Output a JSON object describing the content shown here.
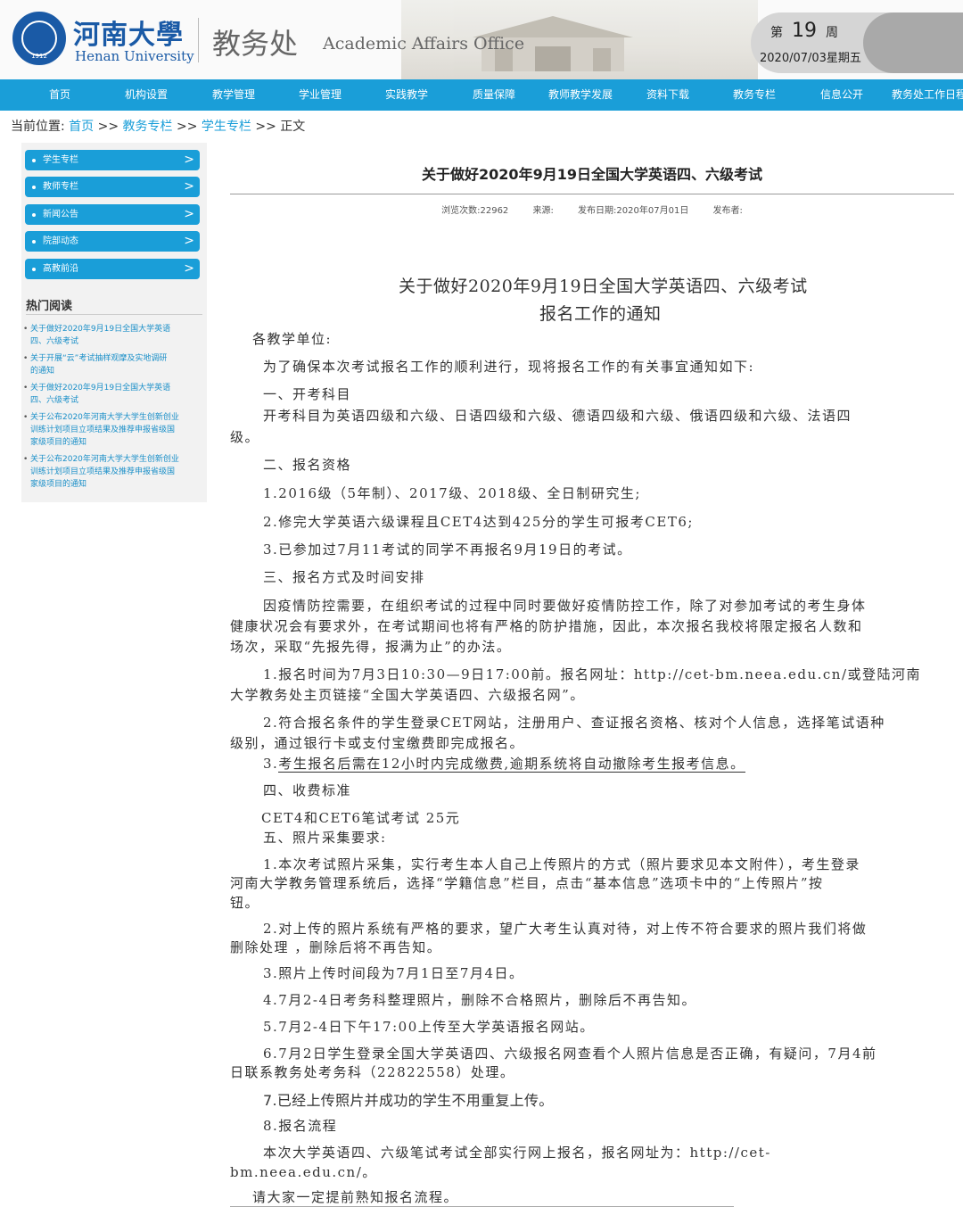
{
  "header": {
    "logo_year": "1912",
    "university_cn": "河南大學",
    "university_en": "Henan University",
    "office_cn": "教务处",
    "office_en": "Academic Affairs Office",
    "week_prefix": "第",
    "week_number": "19",
    "week_suffix": "周",
    "date": "2020/07/03星期五"
  },
  "nav": [
    "首页",
    "机构设置",
    "教学管理",
    "学业管理",
    "实践教学",
    "质量保障",
    "教师教学发展",
    "资料下载",
    "教务专栏",
    "信息公开",
    "教务处工作日程"
  ],
  "breadcrumb": {
    "label": "当前位置:",
    "home": "首页",
    "sep": ">>",
    "level1": "教务专栏",
    "level2": "学生专栏",
    "current": "正文"
  },
  "sidebar": {
    "menu": [
      "学生专栏",
      "教师专栏",
      "新闻公告",
      "院部动态",
      "高教前沿"
    ],
    "arrow": ">",
    "hot_title": "热门阅读",
    "hot": [
      [
        "关于做好2020年9月19日全国大学英语",
        "四、六级考试"
      ],
      [
        "关于开展“云”考试抽样观摩及实地调研",
        "的通知"
      ],
      [
        "关于做好2020年9月19日全国大学英语",
        "四、六级考试"
      ],
      [
        "关于公布2020年河南大学大学生创新创业",
        "训练计划项目立项结果及推荐申报省级国",
        "家级项目的通知"
      ],
      [
        "关于公布2020年河南大学大学生创新创业",
        "训练计划项目立项结果及推荐申报省级国",
        "家级项目的通知"
      ]
    ]
  },
  "article": {
    "title": "关于做好2020年9月19日全国大学英语四、六级考试",
    "meta": {
      "views": "浏览次数:22962",
      "source": "来源:",
      "date": "发布日期:2020年07月01日",
      "author": "发布者:"
    },
    "heading1": "关于做好2020年9月19日全国大学英语四、六级考试",
    "heading2": "报名工作的通知",
    "lines": [
      "各教学单位:",
      "为了确保本次考试报名工作的顺利进行，现将报名工作的有关事宜通知如下:",
      "一、开考科目",
      "开考科目为英语四级和六级、日语四级和六级、德语四级和六级、俄语四级和六级、法语四",
      "级。",
      "二、报名资格",
      "1.2016级（5年制）、2017级、2018级、全日制研究生;",
      "2.修完大学英语六级课程且CET4达到425分的学生可报考CET6;",
      "3.已参加过7月11考试的同学不再报名9月19日的考试。",
      "三、报名方式及时间安排",
      "因疫情防控需要，在组织考试的过程中同时要做好疫情防控工作，除了对参加考试的考生身体",
      "健康状况会有要求外，在考试期间也将有严格的防护措施，因此，本次报名我校将限定报名人数和",
      "场次，采取“先报先得，报满为止”的办法。",
      "1.报名时间为7月3日10:30—9日17:00前。报名网址：http://cet-bm.neea.edu.cn/或登陆河南",
      "大学教务处主页链接“全国大学英语四、六级报名网”。",
      "2.符合报名条件的学生登录CET网站，注册用户、查证报名资格、核对个人信息，选择笔试语种",
      "级别，通过银行卡或支付宝缴费即完成报名。",
      "3.",
      "考生报名后需在12小时内完成缴费,逾期系统将自动撤除考生报考信息。",
      "四、收费标准",
      "CET4和CET6笔试考试 25元",
      "五、照片采集要求:",
      "1.本次考试照片采集，实行考生本人自己上传照片的方式（照片要求见本文附件），考生登录",
      "河南大学教务管理系统后，选择“学籍信息”栏目，点击“基本信息”选项卡中的“上传照片”按",
      "钮。",
      "2.对上传的照片系统有严格的要求，望广大考生认真对待，对上传不符合要求的照片我们将做",
      "删除处理 ，删除后将不再告知。",
      "3.照片上传时间段为7月1日至7月4日。",
      "4.7月2-4日考务科整理照片，删除不合格照片，删除后不再告知。",
      "5.7月2-4日下午17:00上传至大学英语报名网站。",
      "6.7月2日学生登录全国大学英语四、六级报名网查看个人照片信息是否正确，有疑问，7月4前",
      "日联系教务处考务科（22822558）处理。",
      "7.已经上传照片并成功的学生不用重复上传。",
      "8.报名流程",
      "本次大学英语四、六级笔试考试全部实行网上报名，报名网址为：http://cet-",
      "bm.neea.edu.cn/。",
      "请大家一定提前熟知报名流程。"
    ]
  }
}
